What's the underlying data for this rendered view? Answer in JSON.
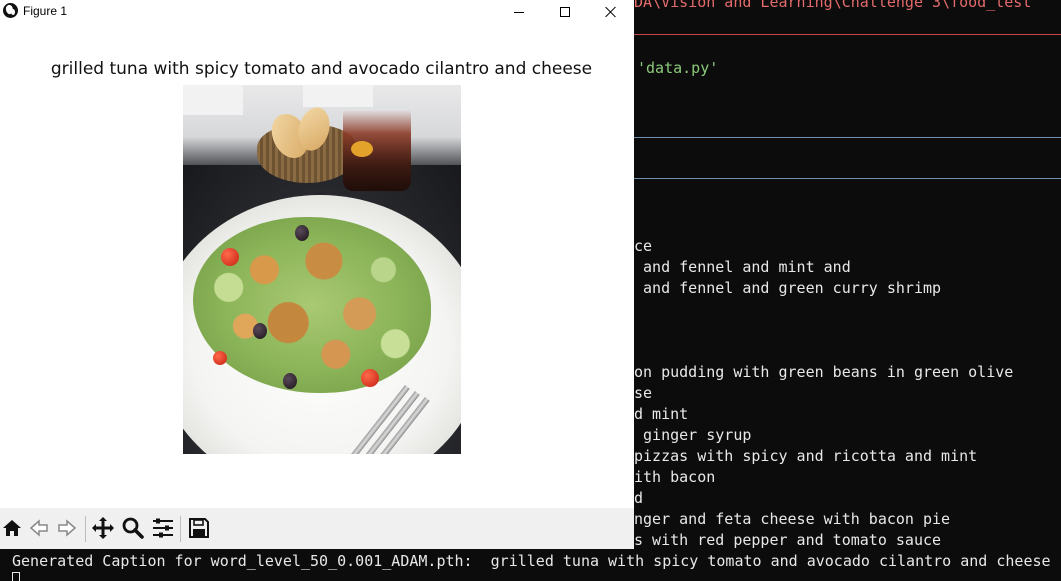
{
  "terminal": {
    "path_fragment": "DA\\Vision and Learning\\Challenge 3\\food_test",
    "file_fragment": "'data.py'",
    "lines": [
      "ce",
      " and fennel and mint and",
      " and fennel and green curry shrimp",
      "on pudding with green beans in green olive",
      "se",
      "d mint",
      " ginger syrup",
      "pizzas with spicy and ricotta and mint",
      "ith bacon",
      "d",
      "nger and feta cheese with bacon pie",
      "s with red pepper and tomato sauce"
    ],
    "caption_line": "Generated Caption for word_level_50_0.001_ADAM.pth:  grilled tuna with spicy tomato and avocado cilantro and cheese"
  },
  "figure": {
    "window_title": "Figure 1",
    "plot_title": "grilled tuna with spicy tomato and avocado cilantro and cheese",
    "image_alt": "salad plate photo",
    "toolbar": [
      "home-icon",
      "back-icon",
      "forward-icon",
      "pan-icon",
      "zoom-icon",
      "configure-subplots-icon",
      "save-icon"
    ]
  },
  "colors": {
    "terminal_bg": "#0c0c0c",
    "terminal_text": "#e8e8e8",
    "path_red": "#e36b6b",
    "string_green": "#8cc97a",
    "window_bg": "#ffffff",
    "toolbar_bg": "#f0f0f0"
  }
}
